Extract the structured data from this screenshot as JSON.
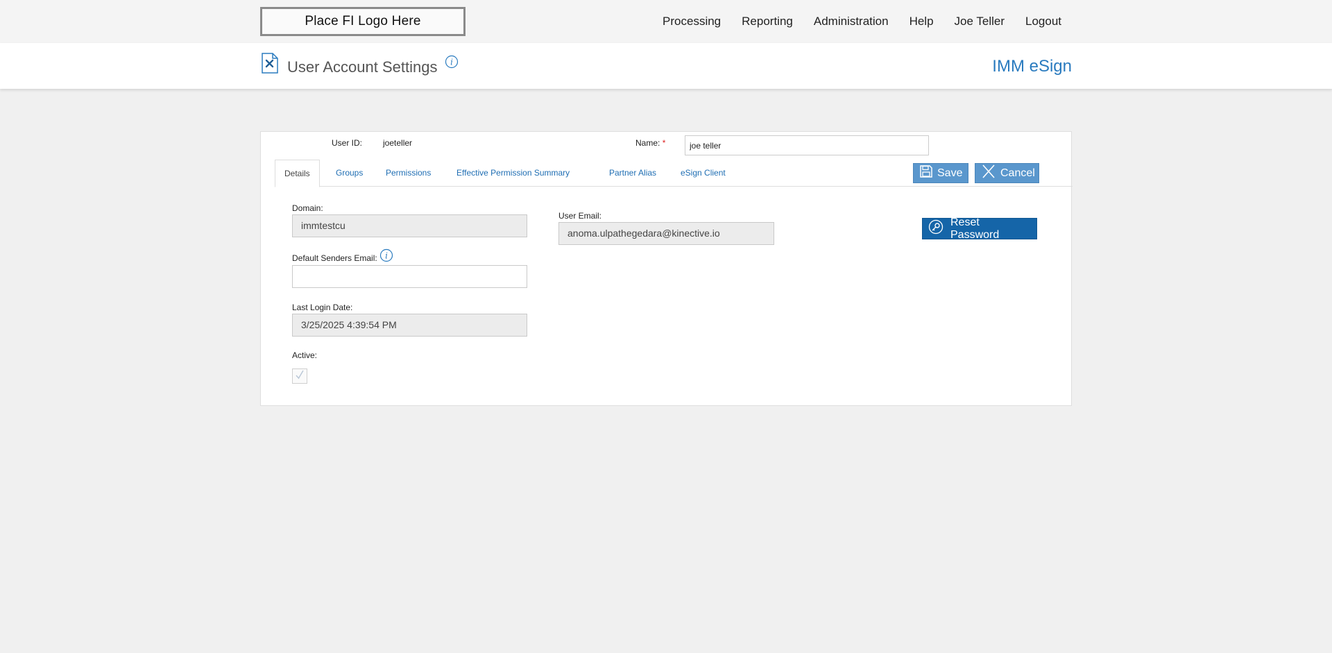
{
  "header": {
    "logo_text": "Place FI Logo Here",
    "nav": [
      "Processing",
      "Reporting",
      "Administration",
      "Help",
      "Joe Teller",
      "Logout"
    ]
  },
  "titlebar": {
    "title": "User Account Settings",
    "brand": "IMM eSign"
  },
  "form": {
    "user_id_label": "User ID:",
    "user_id_value": "joeteller",
    "name_label": "Name:",
    "name_required": "*",
    "name_value": "joe teller"
  },
  "tabs": [
    "Details",
    "Groups",
    "Permissions",
    "Effective Permission Summary",
    "Partner Alias",
    "eSign Client"
  ],
  "actions": {
    "save_label": "Save",
    "cancel_label": "Cancel",
    "reset_password_label": "Reset Password"
  },
  "details": {
    "domain_label": "Domain:",
    "domain_value": "immtestcu",
    "default_senders_email_label": "Default Senders Email:",
    "default_senders_email_value": "",
    "last_login_label": "Last Login Date:",
    "last_login_value": "3/25/2025 4:39:54 PM",
    "active_label": "Active:",
    "active_checked": true,
    "user_email_label": "User Email:",
    "user_email_value": "anoma.ulpathegedara@kinective.io"
  },
  "colors": {
    "accent": "#2a7bbf",
    "button": "#5a97cd",
    "button_dark": "#1565a8"
  }
}
